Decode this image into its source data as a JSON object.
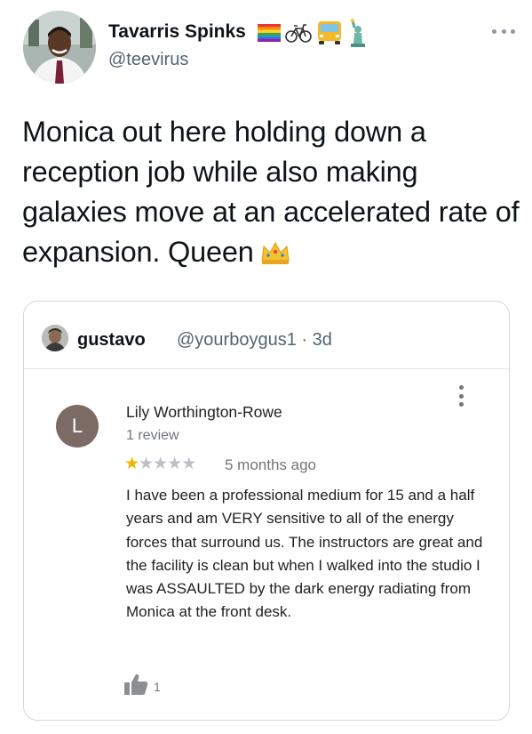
{
  "tweet": {
    "author": {
      "name": "Tavarris Spinks",
      "handle": "@teevirus",
      "badges": [
        "rainbow-flag-icon",
        "bicycle-icon",
        "bus-icon",
        "statue-of-liberty-icon"
      ]
    },
    "text": "Monica out here holding down a reception job while also making galaxies move at an accelerated rate of expansion. Queen",
    "text_emoji": "crown-icon"
  },
  "quote": {
    "author": {
      "name": "gustavo",
      "handle": "@yourboygus1 · 3d"
    },
    "review": {
      "avatar_letter": "L",
      "reviewer": "Lily Worthington-Rowe",
      "review_count": "1 review",
      "rating": 1,
      "rating_max": 5,
      "date": "5 months ago",
      "body": "I have been a professional medium for 15 and a half years and am VERY sensitive to all of the energy forces that surround us. The instructors are great and the facility is clean but when I walked into the studio I was ASSAULTED by the dark energy radiating from Monica at the front desk.",
      "likes": "1"
    }
  },
  "colors": {
    "star_on": "#f4b400",
    "star_off": "#bdc1c6",
    "avatar_l": "#7b6b64",
    "secondary_text": "#536471"
  }
}
